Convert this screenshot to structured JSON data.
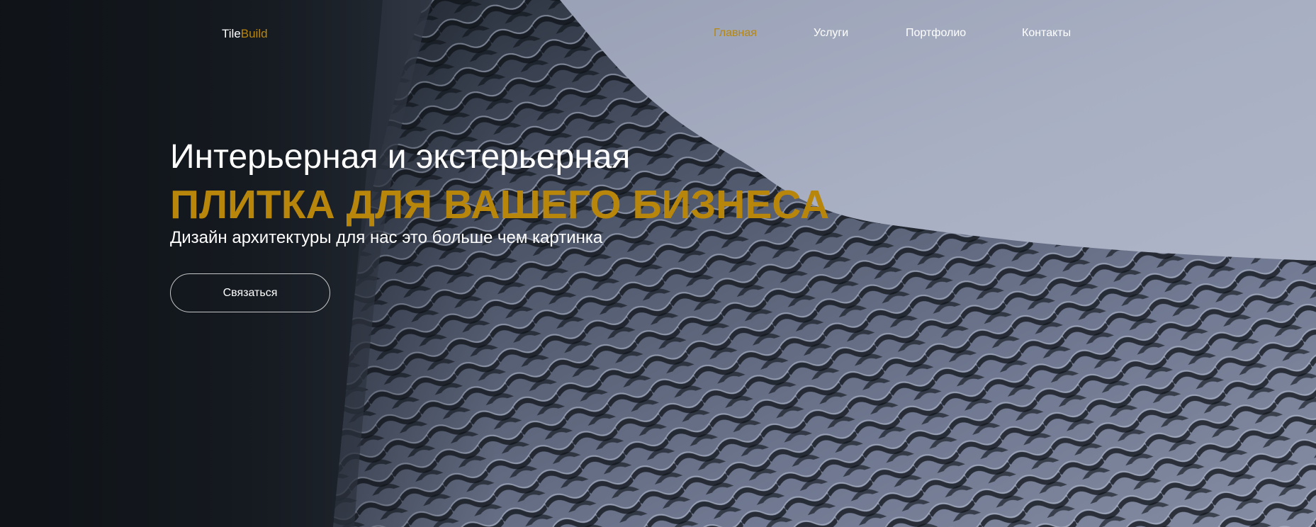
{
  "brand": {
    "name_part_1": "Tile",
    "name_part_2": "Build"
  },
  "nav": {
    "items": [
      {
        "label": "Главная",
        "active": true
      },
      {
        "label": "Услуги",
        "active": false
      },
      {
        "label": "Портфолио",
        "active": false
      },
      {
        "label": "Контакты",
        "active": false
      }
    ]
  },
  "hero": {
    "heading_line_1": "Интерьерная и экстерьерная",
    "heading_line_2": "ПЛИТКА ДЛЯ ВАШЕГО БИЗНЕСА",
    "subheading": "Дизайн архитектуры для нас это больше чем картинка",
    "cta_label": "Связаться"
  },
  "colors": {
    "accent": "#b8860b",
    "text": "#ffffff",
    "dark_bg": "#11161c",
    "sky": "#a9b0c4"
  }
}
